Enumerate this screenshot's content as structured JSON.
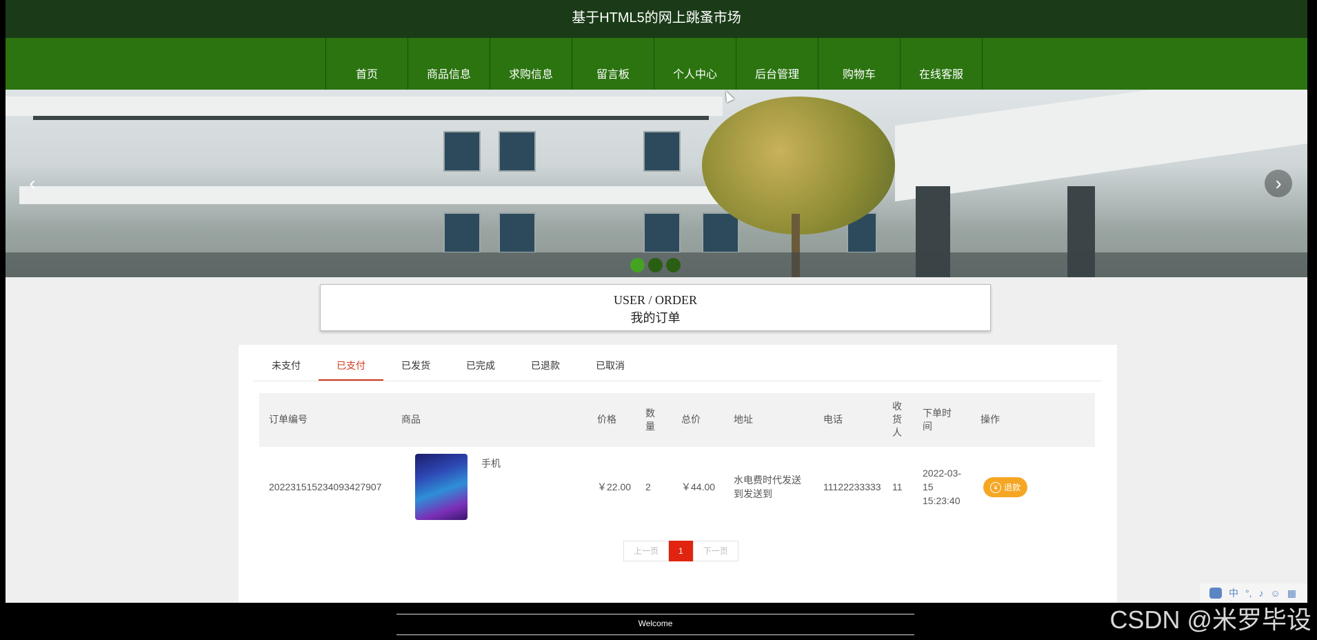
{
  "site_title": "基于HTML5的网上跳蚤市场",
  "nav": [
    "首页",
    "商品信息",
    "求购信息",
    "留言板",
    "个人中心",
    "后台管理",
    "购物车",
    "在线客服"
  ],
  "banner": {
    "prev_label": "‹",
    "next_label": "›",
    "dots": 3,
    "active_dot": 0
  },
  "section_title": {
    "en": "USER / ORDER",
    "cn": "我的订单"
  },
  "tabs": [
    "未支付",
    "已支付",
    "已发货",
    "已完成",
    "已退款",
    "已取消"
  ],
  "active_tab": 1,
  "table": {
    "headers": {
      "order_no": "订单编号",
      "product": "商品",
      "price": "价格",
      "qty": "数量",
      "total": "总价",
      "address": "地址",
      "phone": "电话",
      "receiver": "收货人",
      "time": "下单时间",
      "action": "操作"
    },
    "rows": [
      {
        "order_no": "2022315152340934279 07",
        "product_name": "手机",
        "price": "￥22.00",
        "qty": "2",
        "total": "￥44.00",
        "address": "水电费时代发送到发送到",
        "phone": "11122233333",
        "receiver": "11",
        "time": "2022-03-15 15:23:40",
        "action_label": "退款",
        "action_icon": "yen-coin-icon"
      }
    ]
  },
  "pager": {
    "prev": "上一页",
    "current": "1",
    "next": "下一页"
  },
  "footer": {
    "welcome": "Welcome"
  },
  "watermark": "CSDN @米罗毕设",
  "ime": {
    "mode": "中"
  }
}
